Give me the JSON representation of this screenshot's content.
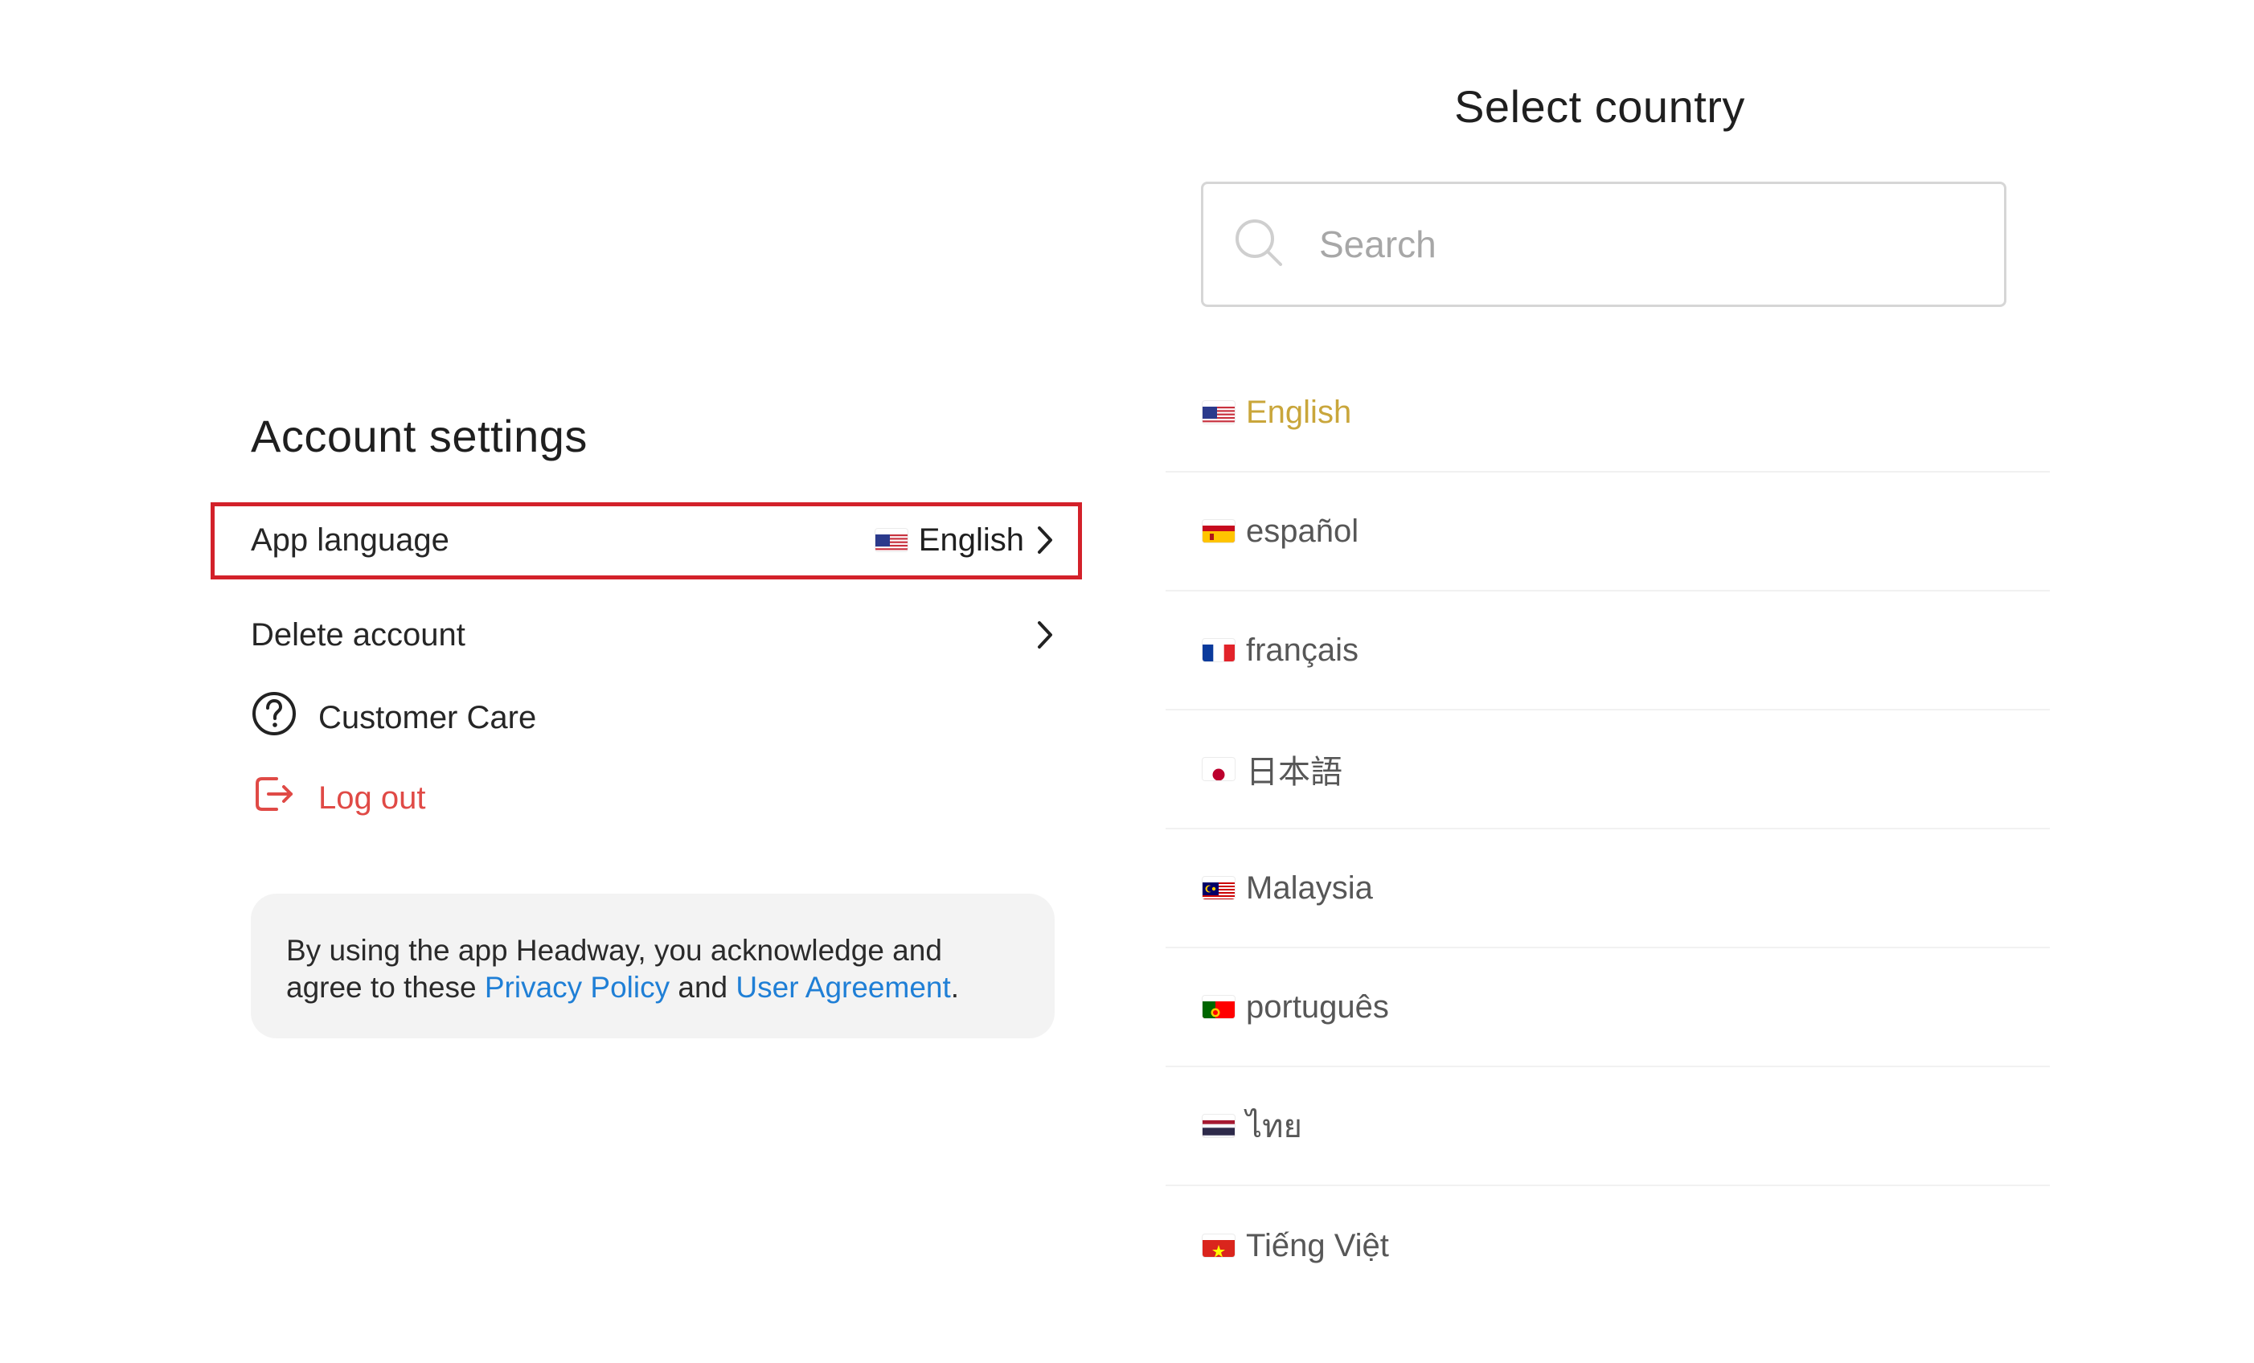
{
  "account": {
    "title": "Account settings",
    "app_language_label": "App language",
    "app_language_value": "English",
    "delete_account_label": "Delete account",
    "customer_care_label": "Customer Care",
    "logout_label": "Log out",
    "legal": {
      "text_1": "By using the app Headway, you acknowledge and",
      "text_2": "agree to these ",
      "privacy_link": "Privacy Policy",
      "and": " and ",
      "agreement_link": "User Agreement",
      "period": "."
    }
  },
  "country_panel": {
    "title": "Select country",
    "search_placeholder": "Search",
    "languages": [
      {
        "label": "English",
        "flag": "us-flag",
        "selected": true
      },
      {
        "label": "español",
        "flag": "spain-flag",
        "selected": false
      },
      {
        "label": "français",
        "flag": "france-flag",
        "selected": false
      },
      {
        "label": "日本語",
        "flag": "japan-flag",
        "selected": false
      },
      {
        "label": "Malaysia",
        "flag": "malaysia-flag",
        "selected": false
      },
      {
        "label": "português",
        "flag": "portugal-flag",
        "selected": false
      },
      {
        "label": "ไทย",
        "flag": "thailand-flag",
        "selected": false
      },
      {
        "label": "Tiếng Việt",
        "flag": "vietnam-flag",
        "selected": false
      }
    ]
  },
  "colors": {
    "highlight_border": "#d3212a",
    "logout": "#e04a46",
    "link": "#1f7fd6",
    "selected_language": "#c9a63b"
  }
}
